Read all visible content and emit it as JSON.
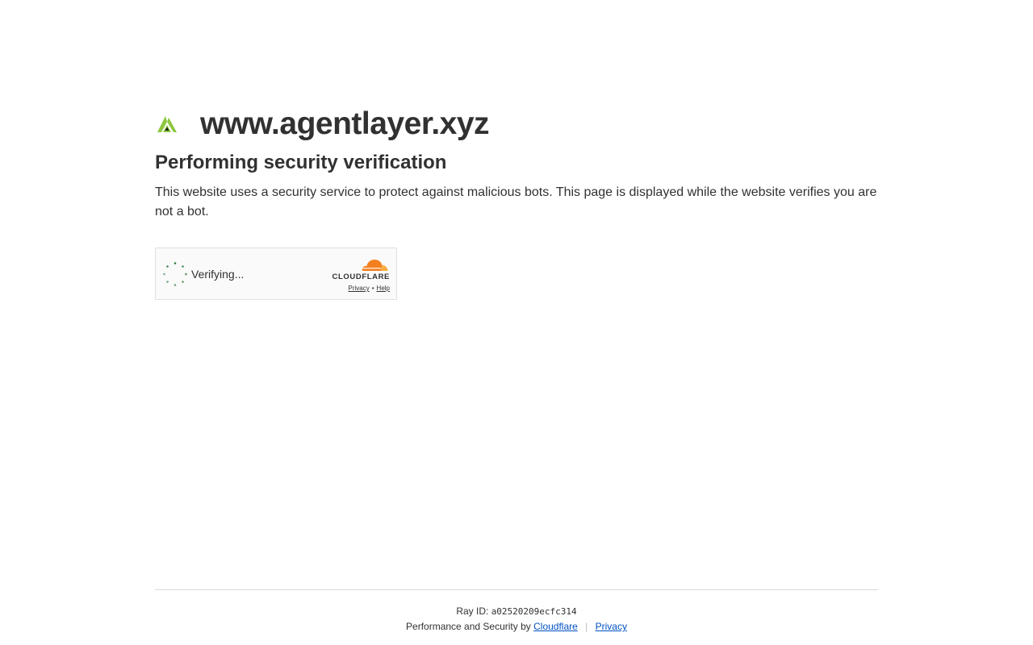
{
  "site": {
    "name": "www.agentlayer.xyz",
    "logo_icon": "agentlayer-logo-icon"
  },
  "challenge": {
    "headline": "Performing security verification",
    "description": "This website uses a security service to protect against malicious bots. This page is displayed while the website verifies you are not a bot."
  },
  "widget": {
    "status_text": "Verifying...",
    "brand": "CLOUDFLARE",
    "privacy_label": "Privacy",
    "separator": "•",
    "help_label": "Help",
    "spinner_icon": "loading-spinner-icon",
    "brand_icon": "cloudflare-cloud-icon"
  },
  "footer": {
    "ray_label": "Ray ID:",
    "ray_id": "a02520209ecfc314",
    "perf_text": "Performance and Security by",
    "cloudflare_link": "Cloudflare",
    "divider": "|",
    "privacy_link": "Privacy"
  },
  "colors": {
    "text": "#313131",
    "link": "#0051c3",
    "logo_green": "#8dc63f",
    "spinner_green": "#2c7a3f",
    "cloudflare_orange": "#f38020",
    "cloudflare_light_orange": "#faae40"
  }
}
